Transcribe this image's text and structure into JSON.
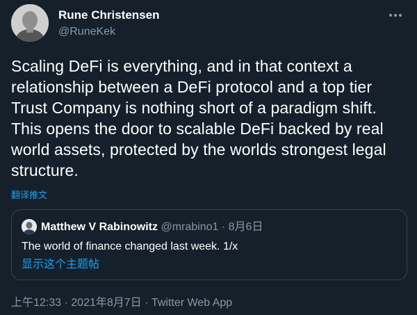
{
  "author": {
    "name": "Rune Christensen",
    "handle": "@RuneKek"
  },
  "tweet": {
    "text": "Scaling DeFi is everything, and in that context a relationship between a DeFi protocol and a top tier Trust Company is nothing short of a paradigm shift. This opens the door to scalable DeFi backed by real world assets, protected by the worlds strongest legal structure.",
    "translate_label": "翻译推文"
  },
  "quoted_tweet": {
    "name": "Matthew V Rabinowitz",
    "handle": "@mrabino1",
    "separator": "·",
    "date": "8月6日",
    "text": "The world of finance changed last week. 1/x",
    "show_thread_label": "显示这个主题帖"
  },
  "footer": {
    "time": "上午12:33",
    "separator1": "·",
    "date": "2021年8月7日",
    "separator2": "·",
    "source": "Twitter Web App"
  },
  "icons": {
    "more": "more-horizontal-icon"
  },
  "colors": {
    "background": "#15202b",
    "primary_text": "#ffffff",
    "secondary_text": "#8899a6",
    "link": "#1da1f2",
    "border": "#38444d"
  }
}
